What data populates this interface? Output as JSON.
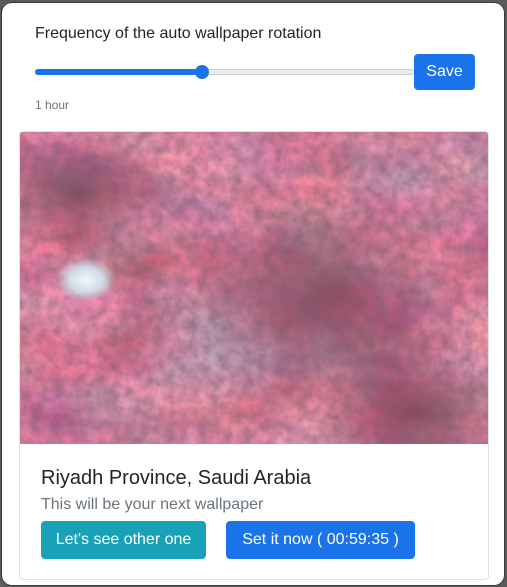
{
  "settings": {
    "frequency_label": "Frequency of the auto wallpaper rotation",
    "frequency_value": "1 hour",
    "slider_level": 0.44,
    "save_label": "Save"
  },
  "wallpaper": {
    "location": "Riyadh Province, Saudi Arabia",
    "subtitle": "This will be your next wallpaper",
    "other_button": "Let's see other one",
    "set_now_button": "Set it now ( 00:59:35 )"
  },
  "colors": {
    "primary": "#1a73e8",
    "info": "#17a2b8",
    "text": "#212529",
    "muted": "#6c757d"
  }
}
